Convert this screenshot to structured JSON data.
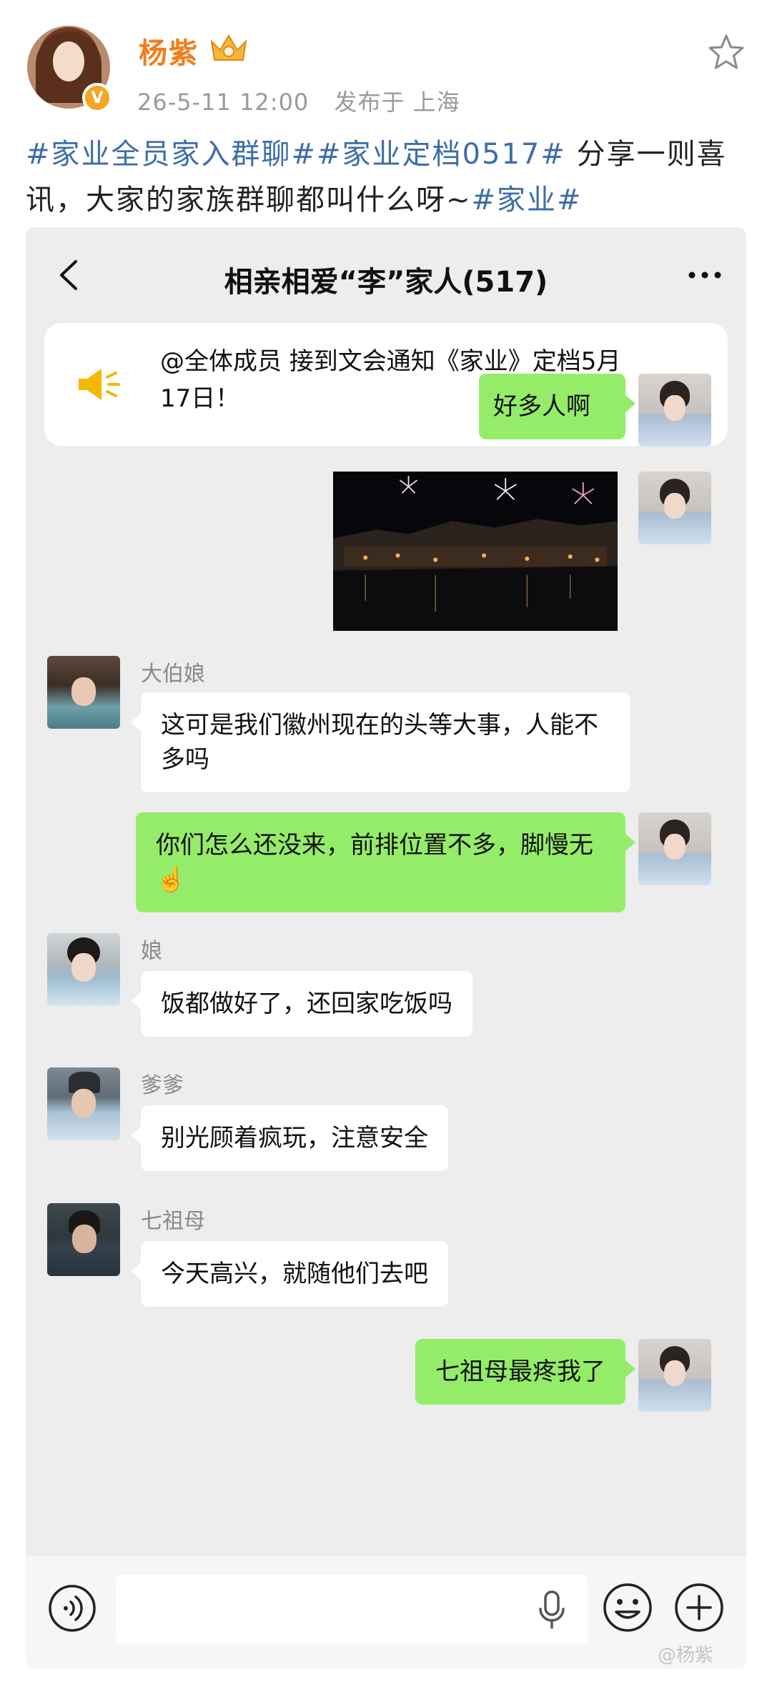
{
  "post": {
    "author_name": "杨紫",
    "date": "26-5-11 12:00",
    "location": "发布于 上海",
    "text_parts": [
      {
        "text": "#家业全员家入群聊##家业定档0517#",
        "type": "hashtag"
      },
      {
        "text": " 分享一则喜讯，大家的家族群聊都叫什么呀~",
        "type": "plain"
      },
      {
        "text": "#家业#",
        "type": "hashtag"
      }
    ]
  },
  "chat": {
    "title": "相亲相爱“李”家人(517)",
    "notice": "@全体成员 接到文会通知《家业》定档5月17日！",
    "messages": [
      {
        "sender": "",
        "side": "out",
        "text": "好多人啊"
      },
      {
        "sender": "",
        "side": "out",
        "type": "image"
      },
      {
        "sender": "大伯娘",
        "side": "in",
        "text": "这可是我们徽州现在的头等大事，人能不多吗"
      },
      {
        "sender": "",
        "side": "out",
        "text": "你们怎么还没来，前排位置不多，脚慢无☝️"
      },
      {
        "sender": "娘",
        "side": "in",
        "text": "饭都做好了，还回家吃饭吗"
      },
      {
        "sender": "爹爹",
        "side": "in",
        "text": "别光顾着疯玩，注意安全"
      },
      {
        "sender": "七祖母",
        "side": "in",
        "text": "今天高兴，就随他们去吧"
      },
      {
        "sender": "",
        "side": "out",
        "text": "七祖母最疼我了"
      }
    ]
  },
  "watermark": "@杨紫",
  "colors": {
    "name_orange": "#f17d1b",
    "hashtag_blue": "#3c6ea9",
    "bubble_green": "#95ec69",
    "chat_bg": "#ededed"
  },
  "icons": [
    "star-icon",
    "vip-crown-icon",
    "verified-icon",
    "back-icon",
    "more-icon",
    "speaker-icon",
    "chevron-right-icon",
    "voice-icon",
    "mic-icon",
    "emoji-icon",
    "plus-icon"
  ]
}
